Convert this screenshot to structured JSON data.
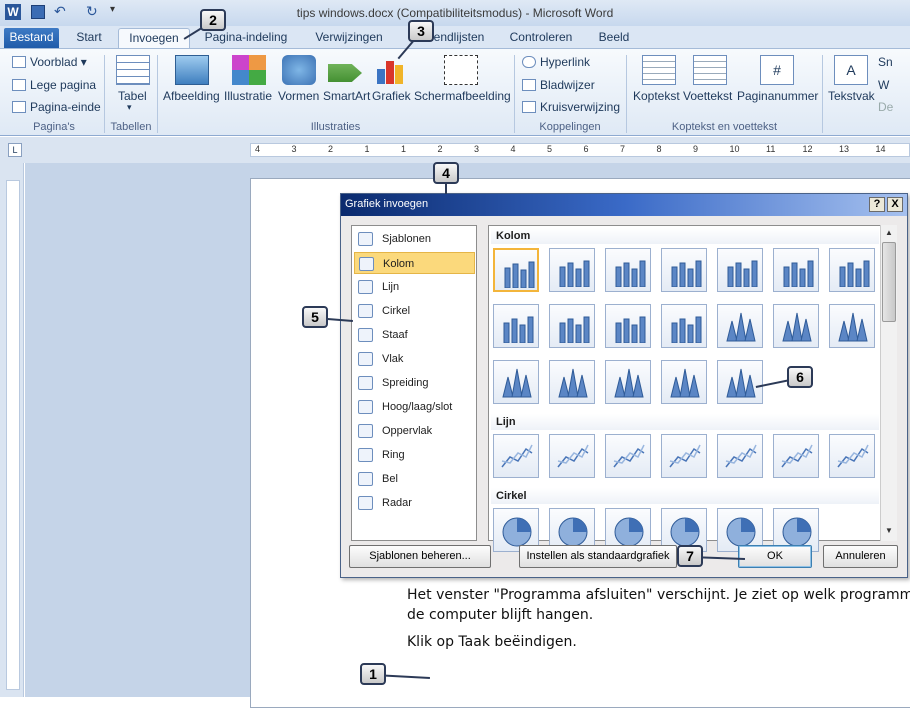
{
  "window": {
    "title": "tips windows.docx (Compatibiliteitsmodus)  -  Microsoft Word"
  },
  "tabs": [
    "Bestand",
    "Start",
    "Invoegen",
    "Pagina-indeling",
    "Verwijzingen",
    "Verzendlijsten",
    "Controleren",
    "Beeld"
  ],
  "ribbon": {
    "pages": {
      "group": "Pagina's",
      "items": [
        "Voorblad",
        "Lege pagina",
        "Pagina-einde"
      ]
    },
    "tables": {
      "group": "Tabellen",
      "label": "Tabel"
    },
    "illustrations": {
      "group": "Illustraties",
      "items": [
        "Afbeelding",
        "Illustratie",
        "Vormen",
        "SmartArt",
        "Grafiek",
        "Schermafbeelding"
      ]
    },
    "links": {
      "group": "Koppelingen",
      "items": [
        "Hyperlink",
        "Bladwijzer",
        "Kruisverwijzing"
      ]
    },
    "header_footer": {
      "group": "Koptekst en voettekst",
      "items": [
        "Koptekst",
        "Voettekst",
        "Paginanummer"
      ]
    },
    "text": {
      "label": "Tekstvak",
      "items": [
        "Sn",
        "W",
        "De"
      ]
    }
  },
  "ruler": {
    "labels": [
      "4",
      "3",
      "2",
      "1",
      "1",
      "2",
      "3",
      "4",
      "5",
      "6",
      "7",
      "8",
      "9",
      "10",
      "11",
      "12",
      "13",
      "14"
    ]
  },
  "document": {
    "line1": "Het venster \"Programma afsluiten\" verschijnt. Je ziet op welk programma",
    "line2": "de computer blijft hangen.",
    "line3": "Klik op Taak beëindigen."
  },
  "dialog": {
    "title": "Grafiek invoegen",
    "help": "?",
    "close": "X",
    "categories": [
      "Sjablonen",
      "Kolom",
      "Lijn",
      "Cirkel",
      "Staaf",
      "Vlak",
      "Spreiding",
      "Hoog/laag/slot",
      "Oppervlak",
      "Ring",
      "Bel",
      "Radar"
    ],
    "selected_category": "Kolom",
    "sections": [
      "Kolom",
      "Lijn",
      "Cirkel"
    ],
    "buttons": {
      "manage": "Sjablonen beheren...",
      "default": "Instellen als standaardgrafiek",
      "ok": "OK",
      "cancel": "Annuleren"
    }
  },
  "callouts": [
    "1",
    "2",
    "3",
    "4",
    "5",
    "6",
    "7"
  ],
  "colors": {
    "accent": "#2b579a",
    "selection": "#fbd97c"
  }
}
